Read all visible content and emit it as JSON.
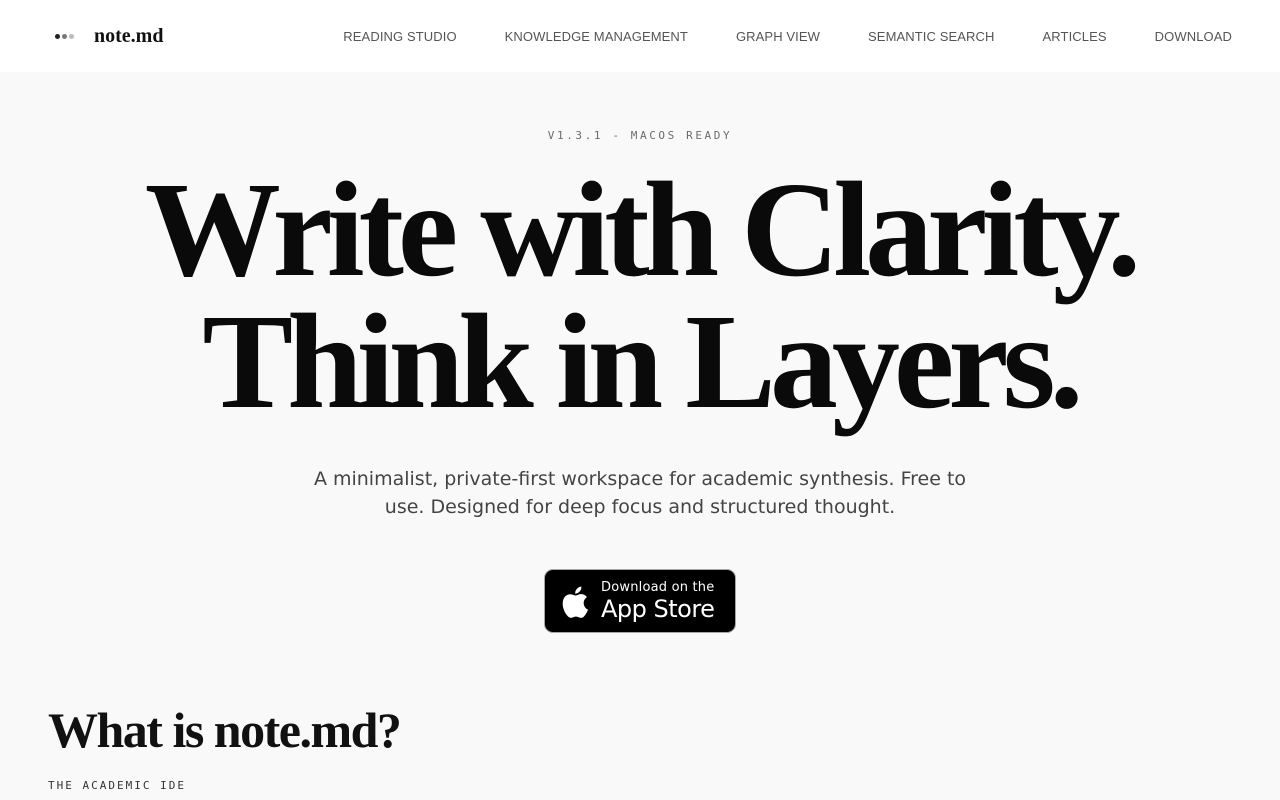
{
  "brand": {
    "name": "note.md",
    "icon": "three-dots-logo-icon",
    "dot_colors": [
      "#222222",
      "#777777",
      "#bbbbbb"
    ]
  },
  "nav": {
    "items": [
      {
        "label": "READING STUDIO"
      },
      {
        "label": "KNOWLEDGE MANAGEMENT"
      },
      {
        "label": "GRAPH VIEW"
      },
      {
        "label": "SEMANTIC SEARCH"
      },
      {
        "label": "ARTICLES"
      },
      {
        "label": "DOWNLOAD"
      }
    ]
  },
  "hero": {
    "version": "V1.3.1 - MACOS READY",
    "headline_line1": "Write with Clarity.",
    "headline_line2": "Think in Layers.",
    "subtitle": "A minimalist, private-first workspace for academic synthesis. Free to use. Designed for deep focus and structured thought."
  },
  "app_store": {
    "small_text": "Download on the",
    "big_text": "App Store",
    "icon": "apple-logo-icon"
  },
  "section": {
    "title": "What is note.md?",
    "eyebrow": "THE ACADEMIC IDE"
  },
  "colors": {
    "background": "#f9f9f9",
    "header": "#ffffff",
    "text": "#0a0a0a",
    "muted": "#555555",
    "button": "#000000"
  }
}
